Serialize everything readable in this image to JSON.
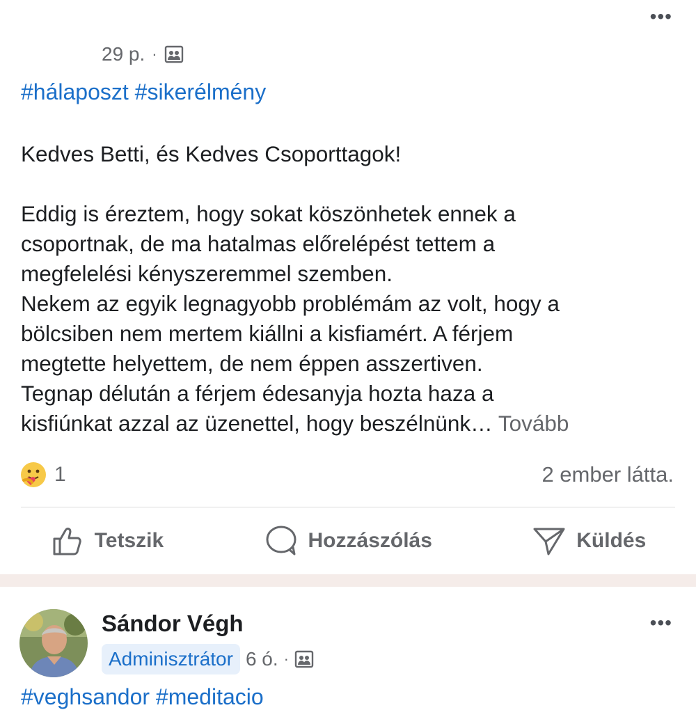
{
  "post1": {
    "time": "29 p.",
    "separator": "·",
    "audience_icon": "group-icon",
    "tags": "#hálaposzt #sikerélmény",
    "greeting": "Kedves Betti, és Kedves Csoporttagok!",
    "paragraph_lines": [
      "Eddig is éreztem, hogy sokat köszönhetek ennek a",
      "csoportnak, de ma hatalmas előrelépést tettem a",
      "megfelelési kényszeremmel szemben.",
      "Nekem az egyik legnagyobb problémám az volt, hogy a",
      "bölcsiben nem mertem kiállni a kisfiamért. A férjem",
      "megtette helyettem, de nem éppen asszertiven.",
      "Tegnap délután a férjem édesanyja hozta haza a",
      "kisfiúnkat azzal az üzenettel, hogy beszélnünk…"
    ],
    "see_more": "Tovább",
    "reaction_icon": "care-reaction-icon",
    "reaction_count": "1",
    "views": "2 ember látta.",
    "more_icon": "more-options-icon"
  },
  "actions": {
    "like": "Tetszik",
    "comment": "Hozzászólás",
    "send": "Küldés"
  },
  "post2": {
    "author": "Sándor Végh",
    "role": "Adminisztrátor",
    "time": "6 ó.",
    "separator": "·",
    "audience_icon": "group-icon",
    "tags": "#veghsandor #meditacio",
    "more_icon": "more-options-icon"
  }
}
